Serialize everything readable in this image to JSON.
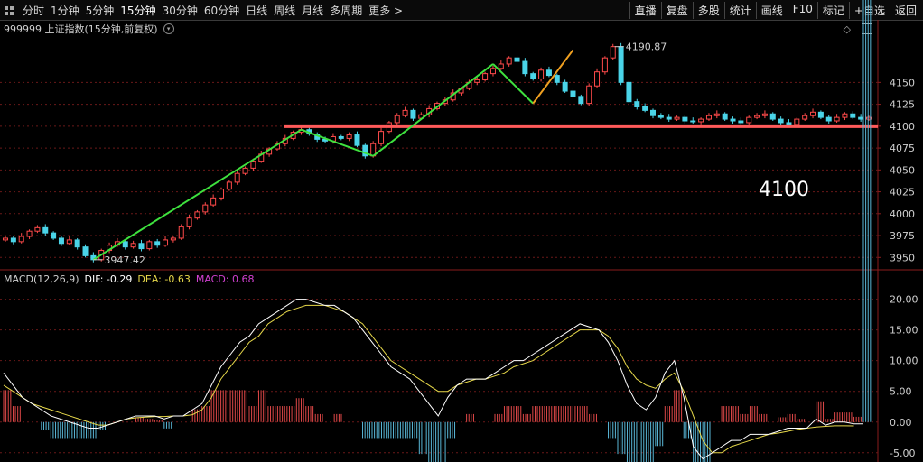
{
  "toolbar": {
    "left": [
      "分时",
      "1分钟",
      "5分钟",
      "15分钟",
      "30分钟",
      "60分钟",
      "日线",
      "周线",
      "月线",
      "多周期",
      "更多 >"
    ],
    "active_index": 3,
    "right": [
      "直播",
      "复盘",
      "多股",
      "统计",
      "画线",
      "F10",
      "标记",
      "+自选",
      "返回"
    ]
  },
  "info": {
    "title": "999999 上证指数(15分钟,前复权)"
  },
  "macd": {
    "label": "MACD(12,26,9)",
    "dif": "DIF: -0.29",
    "dea": "DEA: -0.63",
    "macd": "MACD: 0.68",
    "colors": {
      "dif": "#ffffff",
      "dea": "#e6d84a",
      "macd": "#d040d0",
      "up": "#e04848",
      "down": "#5ab8d8"
    }
  },
  "annotations": {
    "high_label": "4190.87",
    "low_label": "3947.42",
    "level_text": "4100"
  },
  "chart_data": {
    "type": "candlestick",
    "price_axis": {
      "ticks": [
        3950,
        3975,
        4000,
        4025,
        4050,
        4075,
        4100,
        4125,
        4150
      ],
      "range": [
        3940,
        4205
      ]
    },
    "macd_axis": {
      "ticks": [
        "20.00",
        "15.00",
        "10.00",
        "5.00",
        "0.00",
        "-5.00"
      ],
      "range": [
        -6.5,
        22
      ]
    },
    "high": 4190.87,
    "low": 3947.42,
    "support_level": 4100,
    "price_path": [
      3972,
      3968,
      3974,
      3980,
      3984,
      3978,
      3972,
      3966,
      3970,
      3962,
      3952,
      3947.4,
      3958,
      3964,
      3968,
      3962,
      3966,
      3960,
      3968,
      3964,
      3970,
      3972,
      3985,
      3995,
      4002,
      4010,
      4018,
      4028,
      4036,
      4046,
      4052,
      4060,
      4068,
      4074,
      4080,
      4086,
      4093,
      4096,
      4091,
      4085,
      4083,
      4088,
      4086,
      4090,
      4078,
      4066,
      4080,
      4094,
      4104,
      4112,
      4118,
      4109,
      4113,
      4120,
      4126,
      4130,
      4138,
      4143,
      4150,
      4153,
      4160,
      4166,
      4171,
      4178,
      4174,
      4160,
      4154,
      4164,
      4158,
      4150,
      4140,
      4134,
      4126,
      4146,
      4162,
      4178,
      4190.9,
      4150,
      4128,
      4122,
      4118,
      4112,
      4110,
      4108,
      4110,
      4106,
      4105,
      4108,
      4112,
      4114,
      4108,
      4106,
      4104,
      4110,
      4112,
      4114,
      4108,
      4104,
      4102,
      4108,
      4112,
      4116,
      4110,
      4106,
      4110,
      4114,
      4110,
      4108,
      4110
    ],
    "trend_line": [
      [
        11,
        3947.4
      ],
      [
        37,
        4096
      ],
      [
        46,
        4066
      ],
      [
        61,
        4171
      ],
      [
        66,
        4126
      ],
      [
        71,
        4187
      ]
    ],
    "dif": [
      8,
      6,
      4,
      3,
      2,
      1,
      0.5,
      0,
      -0.5,
      -1,
      -1,
      -0.5,
      0,
      0.5,
      1,
      1,
      1,
      0.5,
      1,
      1,
      2,
      3,
      6,
      9,
      11,
      13,
      14,
      16,
      17,
      18,
      19,
      20,
      20,
      19.5,
      19,
      19,
      18,
      17,
      15,
      13,
      11,
      9,
      8,
      7,
      5,
      3,
      1,
      4,
      6,
      7,
      7,
      7,
      8,
      9,
      10,
      10,
      11,
      12,
      13,
      14,
      15,
      16,
      15.5,
      15,
      13,
      10,
      6,
      3,
      2,
      4,
      8,
      10,
      4,
      -4,
      -6,
      -5,
      -4,
      -3,
      -3,
      -2,
      -2,
      -2,
      -1.5,
      -1,
      -1,
      -1,
      0.5,
      -0.5,
      0,
      0,
      -0.3,
      -0.29
    ],
    "dea": [
      6,
      5,
      4,
      3,
      2.5,
      2,
      1.5,
      1,
      0.5,
      0,
      -0.5,
      -0.5,
      0,
      0.5,
      0.7,
      0.8,
      0.9,
      0.9,
      1,
      1,
      1.2,
      2,
      4,
      7,
      9,
      11,
      13,
      14,
      16,
      17,
      18,
      18.5,
      19,
      19,
      19,
      18.5,
      18,
      17,
      16,
      14,
      12,
      10,
      9,
      8,
      7,
      6,
      5,
      5,
      6,
      6.5,
      7,
      7,
      7.5,
      8,
      9,
      9.5,
      10,
      11,
      12,
      13,
      14,
      15,
      15,
      15,
      14,
      12,
      9,
      7,
      6,
      5.5,
      7,
      8,
      5,
      1,
      -3,
      -5,
      -5,
      -4,
      -3.5,
      -3,
      -2.5,
      -2,
      -1.8,
      -1.5,
      -1.2,
      -1,
      -0.8,
      -0.7,
      -0.6,
      -0.6,
      -0.63
    ]
  }
}
